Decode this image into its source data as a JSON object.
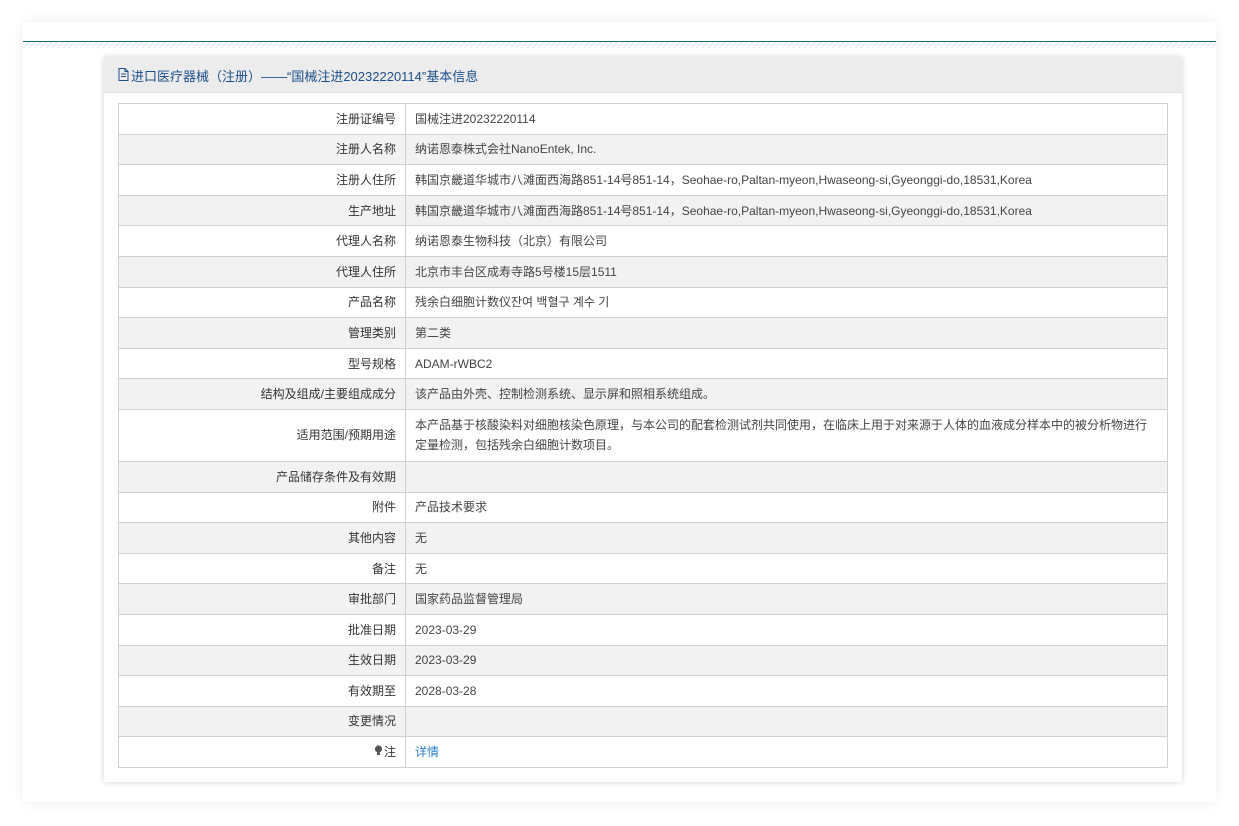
{
  "panel": {
    "title": "进口医疗器械（注册）——“国械注进20232220114”基本信息"
  },
  "rows": [
    {
      "label": "注册证编号",
      "value": "国械注进20232220114"
    },
    {
      "label": "注册人名称",
      "value": "纳诺恩泰株式会社NanoEntek, Inc."
    },
    {
      "label": "注册人住所",
      "value": "韩国京畿道华城市八滩面西海路851-14号851-14，Seohae-ro,Paltan-myeon,Hwaseong-si,Gyeonggi-do,18531,Korea"
    },
    {
      "label": "生产地址",
      "value": "韩国京畿道华城市八滩面西海路851-14号851-14，Seohae-ro,Paltan-myeon,Hwaseong-si,Gyeonggi-do,18531,Korea"
    },
    {
      "label": "代理人名称",
      "value": "纳诺恩泰生物科技（北京）有限公司"
    },
    {
      "label": "代理人住所",
      "value": "北京市丰台区成寿寺路5号楼15层1511"
    },
    {
      "label": "产品名称",
      "value": "残余白细胞计数仪잔여 백혈구 계수 기"
    },
    {
      "label": "管理类别",
      "value": "第二类"
    },
    {
      "label": "型号规格",
      "value": "ADAM-rWBC2"
    },
    {
      "label": "结构及组成/主要组成成分",
      "value": "该产品由外壳、控制检测系统、显示屏和照相系统组成。"
    },
    {
      "label": "适用范围/预期用途",
      "value": "本产品基于核酸染料对细胞核染色原理，与本公司的配套检测试剂共同使用，在临床上用于对来源于人体的血液成分样本中的被分析物进行定量检测，包括残余白细胞计数项目。"
    },
    {
      "label": "产品储存条件及有效期",
      "value": ""
    },
    {
      "label": "附件",
      "value": "产品技术要求"
    },
    {
      "label": "其他内容",
      "value": "无"
    },
    {
      "label": "备注",
      "value": "无"
    },
    {
      "label": "审批部门",
      "value": "国家药品监督管理局"
    },
    {
      "label": "批准日期",
      "value": "2023-03-29"
    },
    {
      "label": "生效日期",
      "value": "2023-03-29"
    },
    {
      "label": "有效期至",
      "value": "2028-03-28"
    },
    {
      "label": "变更情况",
      "value": ""
    }
  ],
  "note_row": {
    "label": "注",
    "link_text": "详情",
    "icon": "lightbulb-icon"
  },
  "colors": {
    "title": "#1a4f8b",
    "link": "#2a7fd0",
    "topline": "#1b6b8a"
  }
}
